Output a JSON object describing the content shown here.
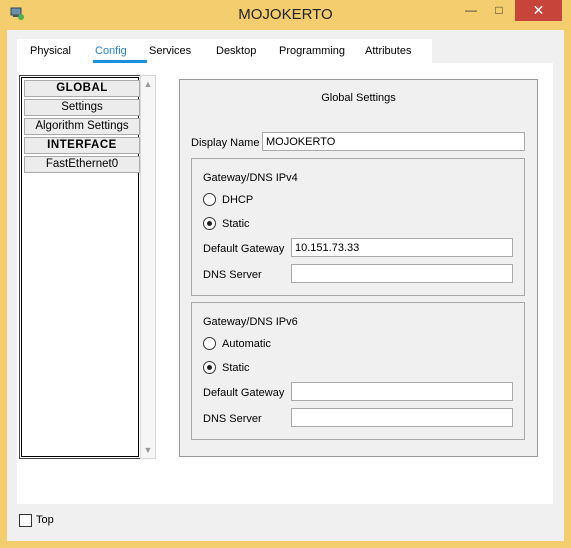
{
  "window": {
    "title": "MOJOKERTO",
    "minimize_symbol": "—",
    "maximize_symbol": "□",
    "close_symbol": "✕",
    "icon": "packet-tracer-device-icon"
  },
  "tabs": [
    {
      "label": "Physical",
      "active": false
    },
    {
      "label": "Config",
      "active": true
    },
    {
      "label": "Services",
      "active": false
    },
    {
      "label": "Desktop",
      "active": false
    },
    {
      "label": "Programming",
      "active": false
    },
    {
      "label": "Attributes",
      "active": false
    }
  ],
  "nav": {
    "items": [
      {
        "label": "GLOBAL",
        "header": true
      },
      {
        "label": "Settings",
        "header": false
      },
      {
        "label": "Algorithm Settings",
        "header": false
      },
      {
        "label": "INTERFACE",
        "header": true
      },
      {
        "label": "FastEthernet0",
        "header": false
      }
    ]
  },
  "global_settings": {
    "title": "Global Settings",
    "display_name_label": "Display Name",
    "display_name_value": "MOJOKERTO",
    "ipv4": {
      "title": "Gateway/DNS IPv4",
      "option_dhcp": "DHCP",
      "option_static": "Static",
      "selected": "Static",
      "gateway_label": "Default Gateway",
      "gateway_value": "10.151.73.33",
      "dns_label": "DNS Server",
      "dns_value": ""
    },
    "ipv6": {
      "title": "Gateway/DNS IPv6",
      "option_auto": "Automatic",
      "option_static": "Static",
      "selected": "Static",
      "gateway_label": "Default Gateway",
      "gateway_value": "",
      "dns_label": "DNS Server",
      "dns_value": ""
    }
  },
  "footer": {
    "top_label": "Top",
    "top_checked": false
  }
}
